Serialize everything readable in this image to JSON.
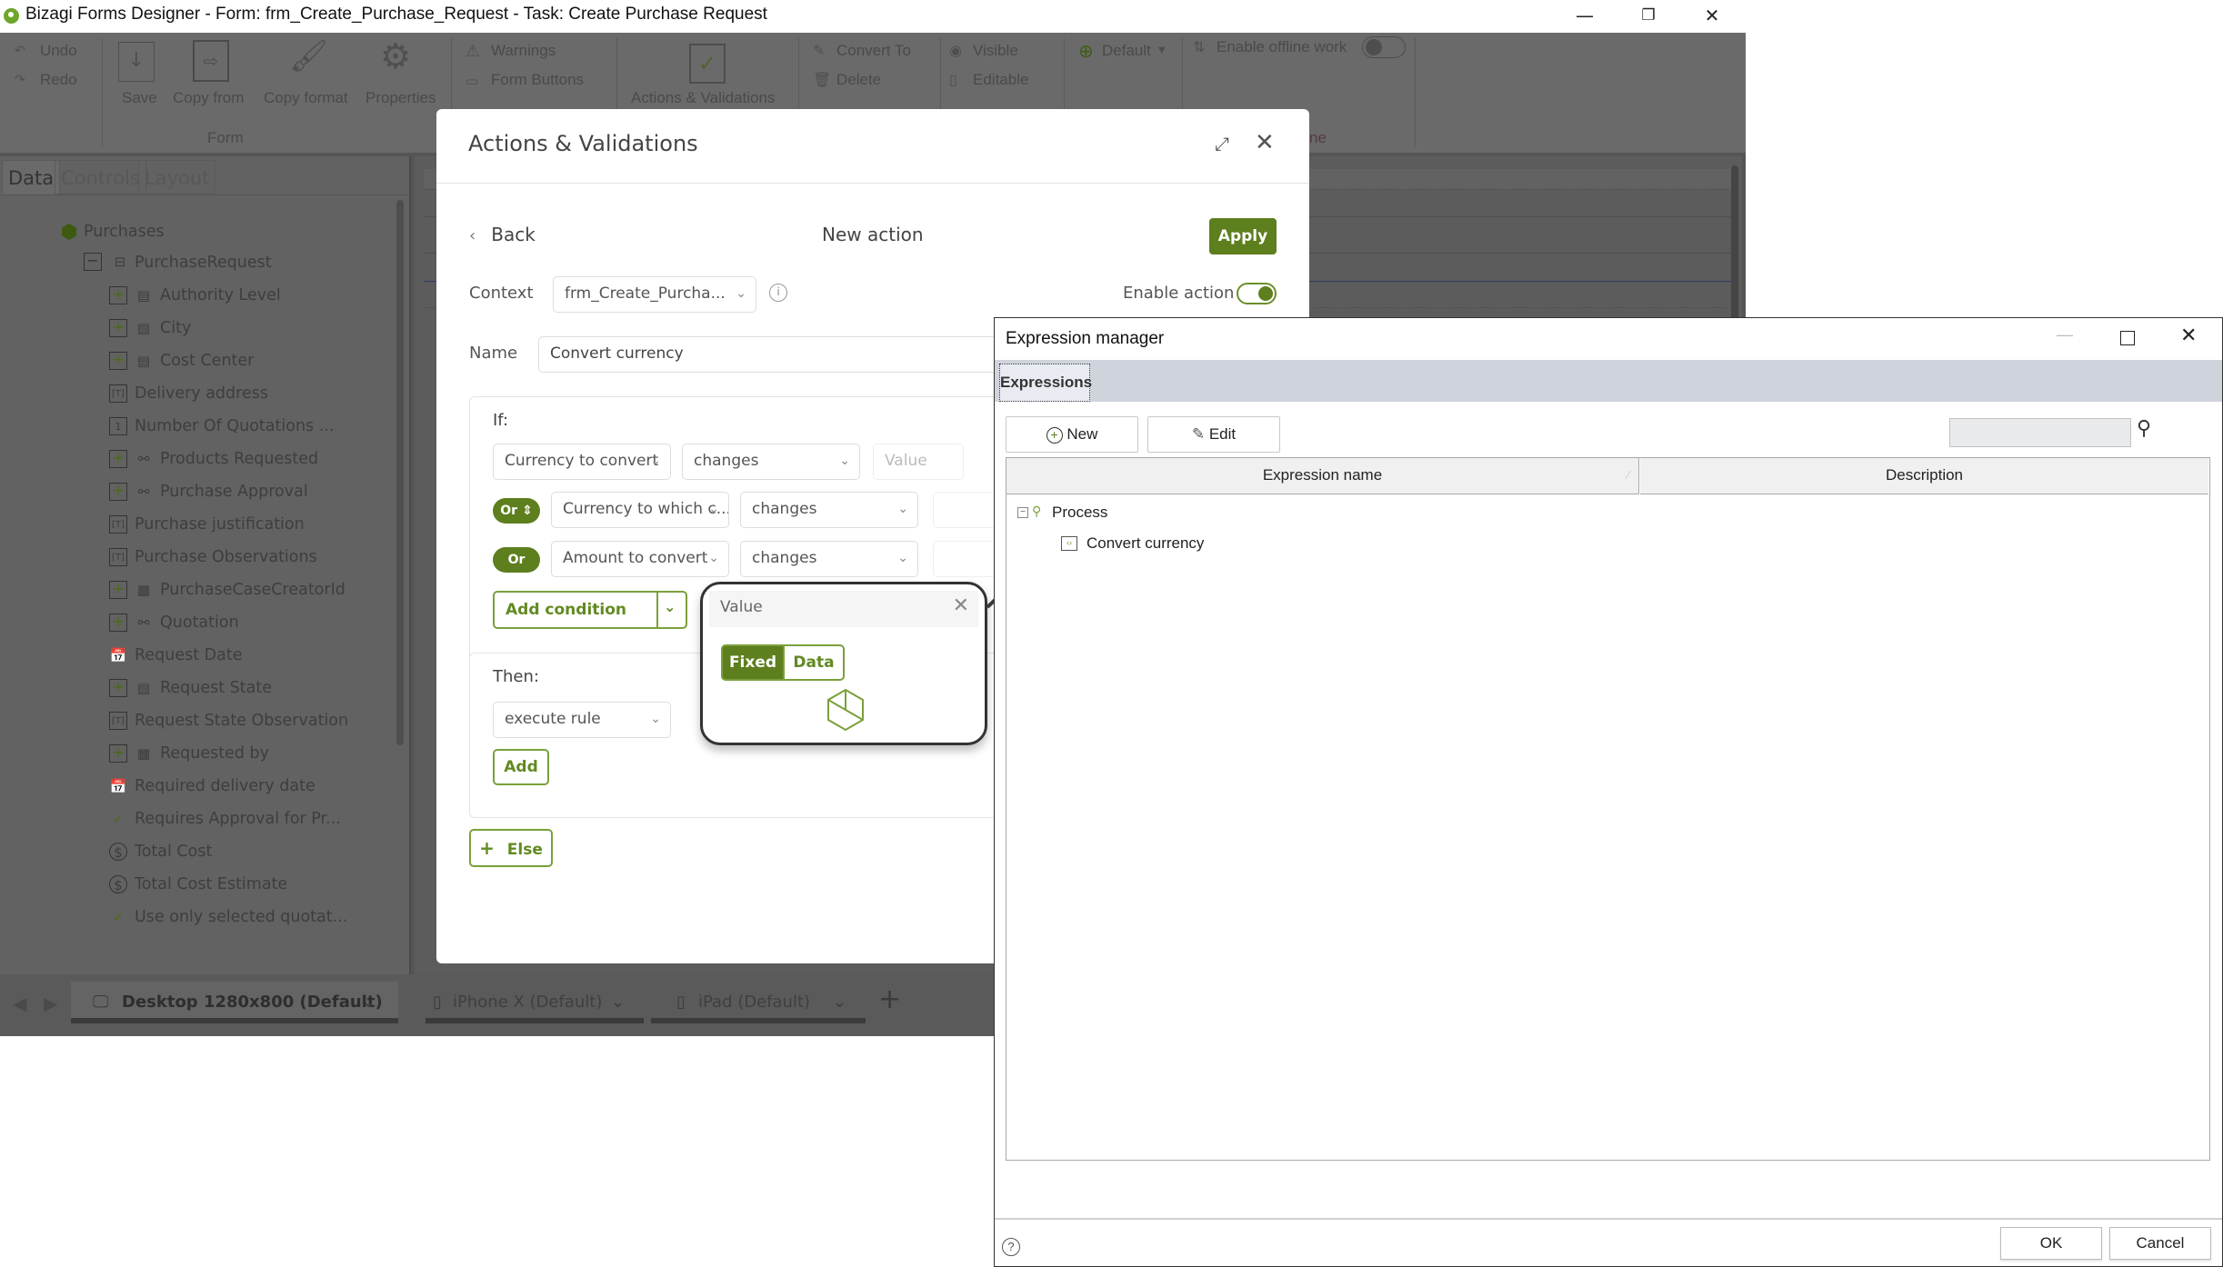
{
  "app": {
    "title": "Bizagi Forms Designer  - Form: frm_Create_Purchase_Request - Task:  Create Purchase Request",
    "window_controls": {
      "minimize": "—",
      "restore": "❐",
      "close": "✕"
    }
  },
  "ribbon": {
    "undo": "Undo",
    "redo": "Redo",
    "save": "Save",
    "copy_from": "Copy from",
    "copy_format": "Copy format",
    "properties": "Properties",
    "form_group": "Form",
    "warnings": "Warnings",
    "form_buttons": "Form Buttons",
    "actions_validations": "Actions & Validations",
    "convert_to": "Convert To",
    "delete": "Delete",
    "visible": "Visible",
    "editable": "Editable",
    "default": "Default",
    "enable_offline_work": "Enable offline work",
    "offline_group_partial": "ne"
  },
  "left_panel": {
    "tabs": [
      "Data",
      "Controls",
      "Layout"
    ],
    "active_tab": "Data",
    "root": "Purchases",
    "entity": "PurchaseRequest",
    "items": [
      {
        "label": "Authority Level",
        "icon": "entity-list-icon",
        "expandable": true
      },
      {
        "label": "City",
        "icon": "entity-list-icon",
        "expandable": true
      },
      {
        "label": "Cost Center",
        "icon": "entity-list-icon",
        "expandable": true
      },
      {
        "label": "Delivery address",
        "icon": "text-field-icon",
        "expandable": false
      },
      {
        "label": "Number Of Quotations ...",
        "icon": "number-icon",
        "expandable": false
      },
      {
        "label": "Products Requested",
        "icon": "collection-icon",
        "expandable": true
      },
      {
        "label": "Purchase Approval",
        "icon": "collection-icon",
        "expandable": true
      },
      {
        "label": "Purchase justification",
        "icon": "text-field-icon",
        "expandable": false
      },
      {
        "label": "Purchase Observations",
        "icon": "text-field-icon",
        "expandable": false
      },
      {
        "label": "PurchaseCaseCreatorId",
        "icon": "entity-table-icon",
        "expandable": true
      },
      {
        "label": "Quotation",
        "icon": "collection-icon",
        "expandable": true
      },
      {
        "label": "Request Date",
        "icon": "date-icon",
        "expandable": false
      },
      {
        "label": "Request State",
        "icon": "entity-list-icon",
        "expandable": true
      },
      {
        "label": "Request State Observation",
        "icon": "text-field-icon",
        "expandable": false
      },
      {
        "label": "Requested by",
        "icon": "entity-table-icon",
        "expandable": true
      },
      {
        "label": "Required delivery date",
        "icon": "date-icon",
        "expandable": false
      },
      {
        "label": "Requires Approval for Pr...",
        "icon": "boolean-icon",
        "expandable": false
      },
      {
        "label": "Total Cost",
        "icon": "currency-icon",
        "expandable": false
      },
      {
        "label": "Total Cost Estimate",
        "icon": "currency-icon",
        "expandable": false
      },
      {
        "label": "Use only selected quotat...",
        "icon": "boolean-icon",
        "expandable": false
      }
    ]
  },
  "device_bar": {
    "desktop": "Desktop 1280x800 (Default)",
    "iphone": "iPhone X (Default)",
    "ipad": "iPad (Default)",
    "add": "+"
  },
  "actions_dialog": {
    "title": "Actions & Validations",
    "back": "Back",
    "heading": "New action",
    "apply": "Apply",
    "context_label": "Context",
    "context_value": "frm_Create_Purcha...",
    "enable_action_label": "Enable action",
    "enable_action_on": true,
    "name_label": "Name",
    "name_value": "Convert currency",
    "if_label": "If:",
    "conditions": [
      {
        "connector": "",
        "field": "Currency to convert",
        "operator": "changes",
        "value_placeholder": "Value"
      },
      {
        "connector": "Or",
        "field": "Currency to which c...",
        "operator": "changes"
      },
      {
        "connector": "Or",
        "field": "Amount to convert",
        "operator": "changes"
      }
    ],
    "add_condition": "Add condition",
    "then_label": "Then:",
    "then_action": "execute rule",
    "add": "Add",
    "else": "Else"
  },
  "value_popup": {
    "title": "Value",
    "fixed": "Fixed",
    "data": "Data",
    "selected": "Fixed"
  },
  "expression_manager": {
    "title": "Expression manager",
    "tab": "Expressions",
    "new": "New",
    "edit": "Edit",
    "search_value": "",
    "columns": [
      "Expression name",
      "Description"
    ],
    "tree": [
      {
        "label": "Process",
        "level": 0,
        "expanded": true
      },
      {
        "label": "Convert currency",
        "level": 1
      }
    ],
    "ok": "OK",
    "cancel": "Cancel"
  },
  "colors": {
    "bizagi_green": "#5e7f1e",
    "green_light": "#7aa03b"
  }
}
